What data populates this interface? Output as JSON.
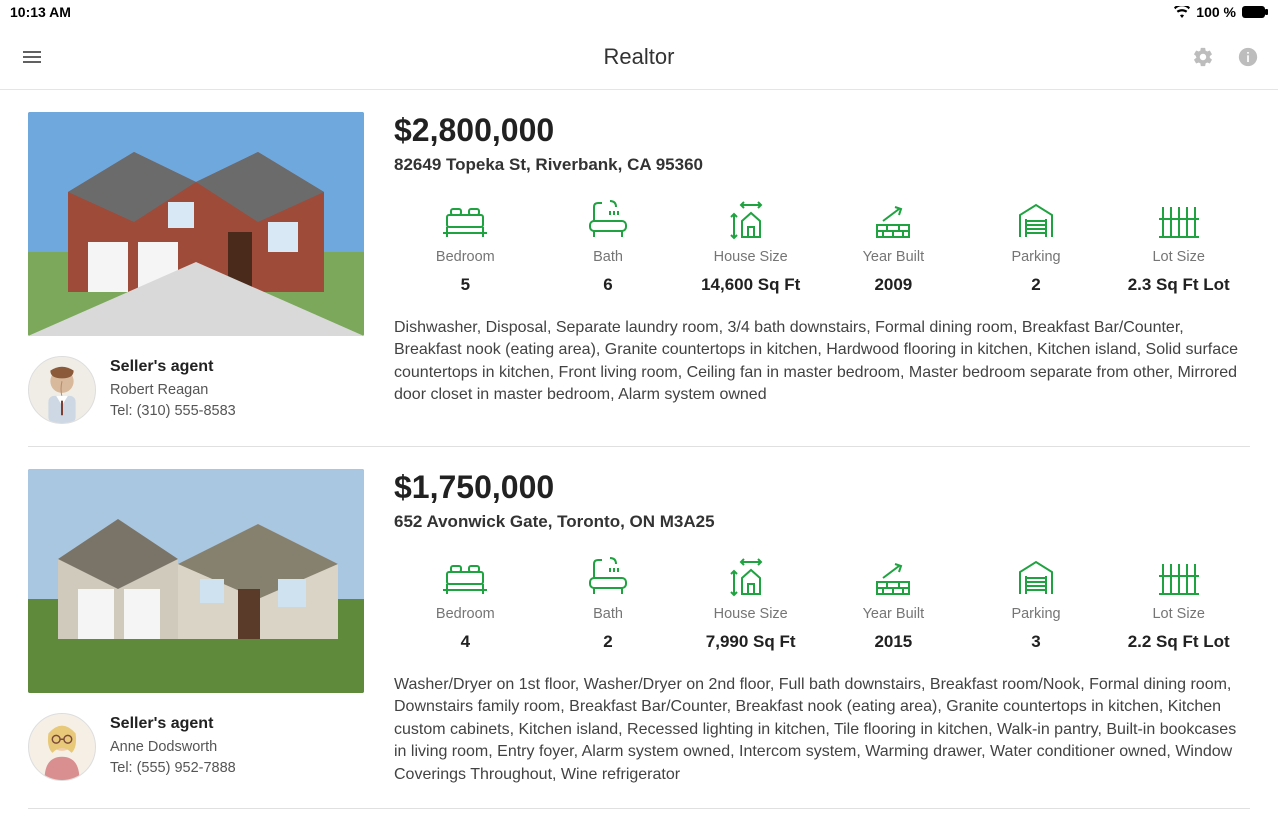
{
  "status_bar": {
    "time": "10:13 AM",
    "battery": "100 %"
  },
  "header": {
    "title": "Realtor"
  },
  "listings": [
    {
      "price": "$2,800,000",
      "address": "82649 Topeka St, Riverbank, CA 95360",
      "stats": {
        "bedroom_label": "Bedroom",
        "bedroom_value": "5",
        "bath_label": "Bath",
        "bath_value": "6",
        "size_label": "House Size",
        "size_value": "14,600 Sq Ft",
        "year_label": "Year Built",
        "year_value": "2009",
        "parking_label": "Parking",
        "parking_value": "2",
        "lot_label": "Lot Size",
        "lot_value": "2.3 Sq Ft Lot"
      },
      "description": "Dishwasher, Disposal, Separate laundry room, 3/4 bath downstairs, Formal dining room, Breakfast Bar/Counter, Breakfast nook (eating area), Granite countertops in kitchen, Hardwood flooring in kitchen, Kitchen island, Solid surface countertops in kitchen, Front living room, Ceiling fan in master bedroom, Master bedroom separate from other, Mirrored door closet in master bedroom, Alarm system owned",
      "agent": {
        "role": "Seller's agent",
        "name": "Robert Reagan",
        "phone": "Tel: (310) 555-8583"
      }
    },
    {
      "price": "$1,750,000",
      "address": "652 Avonwick Gate, Toronto, ON M3A25",
      "stats": {
        "bedroom_label": "Bedroom",
        "bedroom_value": "4",
        "bath_label": "Bath",
        "bath_value": "2",
        "size_label": "House Size",
        "size_value": "7,990 Sq Ft",
        "year_label": "Year Built",
        "year_value": "2015",
        "parking_label": "Parking",
        "parking_value": "3",
        "lot_label": "Lot Size",
        "lot_value": "2.2 Sq Ft Lot"
      },
      "description": "Washer/Dryer on 1st floor, Washer/Dryer on 2nd floor, Full bath downstairs, Breakfast room/Nook, Formal dining room, Downstairs family room, Breakfast Bar/Counter, Breakfast nook (eating area), Granite countertops in kitchen, Kitchen custom cabinets, Kitchen island, Recessed lighting in kitchen, Tile flooring in kitchen, Walk-in pantry, Built-in bookcases in living room, Entry foyer, Alarm system owned, Intercom system, Warming drawer, Water conditioner owned, Window Coverings Throughout, Wine refrigerator",
      "agent": {
        "role": "Seller's agent",
        "name": "Anne Dodsworth",
        "phone": "Tel: (555) 952-7888"
      }
    }
  ]
}
